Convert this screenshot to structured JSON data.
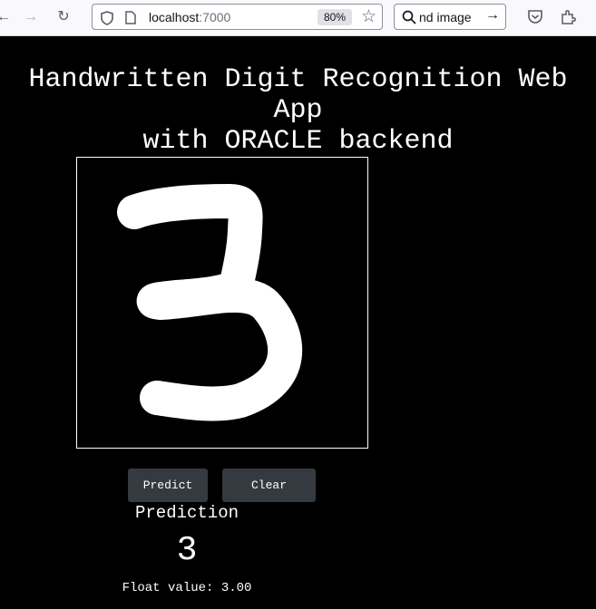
{
  "browser": {
    "url_host": "localhost",
    "url_port": ":7000",
    "zoom": "80%",
    "search_text": "nd image"
  },
  "page": {
    "title_line1": "Handwritten Digit Recognition Web App",
    "title_line2": "with ORACLE backend",
    "predict_label": "Predict",
    "clear_label": "Clear",
    "prediction_heading": "Prediction",
    "prediction_value": "3",
    "float_label": "Float value:",
    "float_value": "3.00"
  }
}
